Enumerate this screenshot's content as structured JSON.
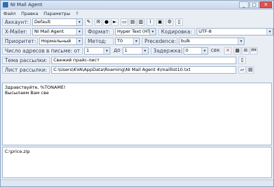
{
  "window": {
    "title": "NI Mail Agent",
    "controls": [
      "_",
      "□",
      "✕"
    ]
  },
  "menu": [
    "Файл",
    "Правка",
    "Параметры",
    "?"
  ],
  "account": {
    "label": "Аккаунт:",
    "value": "Default"
  },
  "xmailer": {
    "label": "X-Mailer:",
    "value": "NI Mail Agent"
  },
  "format": {
    "label": "Формат:",
    "value": "Hyper Text (HTM"
  },
  "encoding": {
    "label": "Кодировка:",
    "value": "UTF-8"
  },
  "priority": {
    "label": "Приоритет:",
    "value": "Нормальный"
  },
  "method": {
    "label": "Метод:",
    "value": "T0"
  },
  "precedence": {
    "label": "Precedence:",
    "value": "bulk"
  },
  "addresses": {
    "label": "Число адресов в письме: от",
    "from": "1",
    "to_label": "до",
    "to": "1"
  },
  "delay": {
    "label": "Задержка:",
    "value": "0",
    "unit": "сек"
  },
  "subject": {
    "label": "Тема рассылки:",
    "value": "Свежий прайс-лист"
  },
  "mailinglist": {
    "label": "Лист рассылки:",
    "value": "C:\\Users\\KVA\\AppData\\Roaming\\NI Mail Agent 4\\maillist10.txt"
  },
  "body": {
    "line1": "Здравствуйте, %TONAME!",
    "line2": "Высылаем Вам све"
  },
  "attachments": {
    "item1": "C:\\price.zip"
  }
}
